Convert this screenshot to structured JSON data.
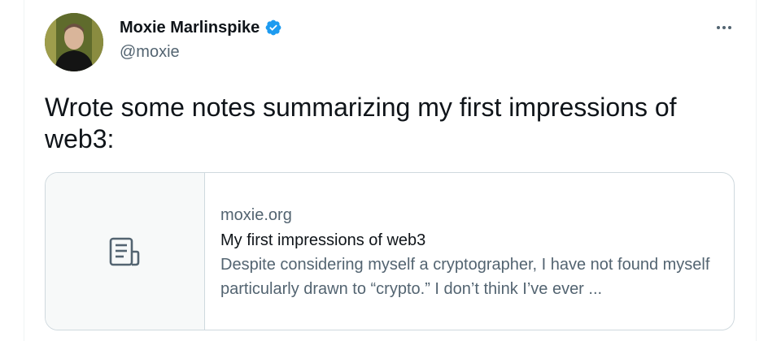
{
  "author": {
    "name": "Moxie Marlinspike",
    "handle": "@moxie",
    "verified": true
  },
  "tweet": {
    "text": "Wrote some notes summarizing my first impressions of\nweb3:"
  },
  "link_card": {
    "domain": "moxie.org",
    "title": "My first impressions of web3",
    "description": "Despite considering myself a cryptographer, I have not found myself particularly drawn to “crypto.” I don’t think I’ve ever ..."
  },
  "icons": {
    "verified": "verified-badge-icon",
    "more": "more-horizontal-icon",
    "card_placeholder": "document-icon"
  },
  "colors": {
    "accent": "#1d9bf0",
    "text": "#0f1419",
    "secondary": "#536471",
    "border": "#cfd9de"
  }
}
